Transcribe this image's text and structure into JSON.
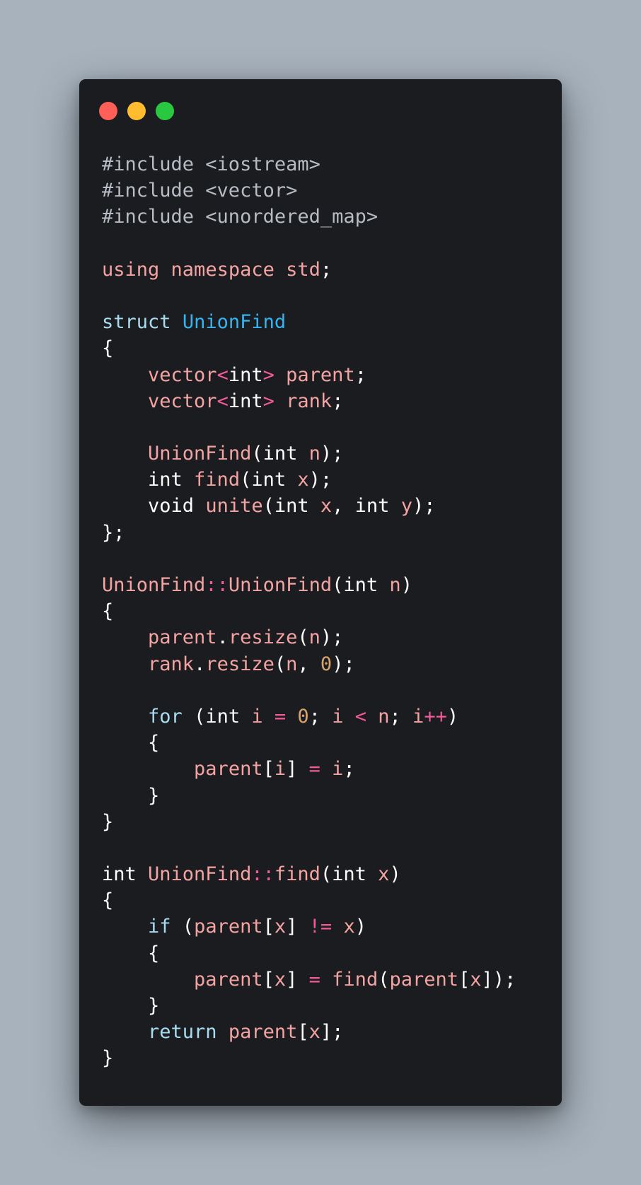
{
  "window": {
    "controls": [
      {
        "name": "close",
        "color": "#fe5f57"
      },
      {
        "name": "minimize",
        "color": "#febc2e"
      },
      {
        "name": "maximize",
        "color": "#28c840"
      }
    ]
  },
  "code": {
    "language": "cpp",
    "lines": [
      [
        {
          "t": "#include <iostream>",
          "c": "pre"
        }
      ],
      [
        {
          "t": "#include <vector>",
          "c": "pre"
        }
      ],
      [
        {
          "t": "#include <unordered_map>",
          "c": "pre"
        }
      ],
      [],
      [
        {
          "t": "using",
          "c": "kw"
        },
        {
          "t": " ",
          "c": "plain"
        },
        {
          "t": "namespace",
          "c": "kw"
        },
        {
          "t": " ",
          "c": "plain"
        },
        {
          "t": "std",
          "c": "kw"
        },
        {
          "t": ";",
          "c": "plain"
        }
      ],
      [],
      [
        {
          "t": "struct",
          "c": "struct"
        },
        {
          "t": " ",
          "c": "plain"
        },
        {
          "t": "UnionFind",
          "c": "type"
        }
      ],
      [
        {
          "t": "{",
          "c": "plain"
        }
      ],
      [
        {
          "t": "    ",
          "c": "plain"
        },
        {
          "t": "vector",
          "c": "ident"
        },
        {
          "t": "<",
          "c": "op"
        },
        {
          "t": "int",
          "c": "plain"
        },
        {
          "t": ">",
          "c": "op"
        },
        {
          "t": " ",
          "c": "plain"
        },
        {
          "t": "parent",
          "c": "ident"
        },
        {
          "t": ";",
          "c": "plain"
        }
      ],
      [
        {
          "t": "    ",
          "c": "plain"
        },
        {
          "t": "vector",
          "c": "ident"
        },
        {
          "t": "<",
          "c": "op"
        },
        {
          "t": "int",
          "c": "plain"
        },
        {
          "t": ">",
          "c": "op"
        },
        {
          "t": " ",
          "c": "plain"
        },
        {
          "t": "rank",
          "c": "ident"
        },
        {
          "t": ";",
          "c": "plain"
        }
      ],
      [],
      [
        {
          "t": "    ",
          "c": "plain"
        },
        {
          "t": "UnionFind",
          "c": "ident"
        },
        {
          "t": "(int ",
          "c": "plain"
        },
        {
          "t": "n",
          "c": "ident"
        },
        {
          "t": ");",
          "c": "plain"
        }
      ],
      [
        {
          "t": "    int ",
          "c": "plain"
        },
        {
          "t": "find",
          "c": "ident"
        },
        {
          "t": "(int ",
          "c": "plain"
        },
        {
          "t": "x",
          "c": "ident"
        },
        {
          "t": ");",
          "c": "plain"
        }
      ],
      [
        {
          "t": "    void ",
          "c": "plain"
        },
        {
          "t": "unite",
          "c": "ident"
        },
        {
          "t": "(int ",
          "c": "plain"
        },
        {
          "t": "x",
          "c": "ident"
        },
        {
          "t": ", int ",
          "c": "plain"
        },
        {
          "t": "y",
          "c": "ident"
        },
        {
          "t": ");",
          "c": "plain"
        }
      ],
      [
        {
          "t": "};",
          "c": "plain"
        }
      ],
      [],
      [
        {
          "t": "UnionFind",
          "c": "ident"
        },
        {
          "t": "::",
          "c": "op"
        },
        {
          "t": "UnionFind",
          "c": "ident"
        },
        {
          "t": "(int ",
          "c": "plain"
        },
        {
          "t": "n",
          "c": "ident"
        },
        {
          "t": ")",
          "c": "plain"
        }
      ],
      [
        {
          "t": "{",
          "c": "plain"
        }
      ],
      [
        {
          "t": "    ",
          "c": "plain"
        },
        {
          "t": "parent",
          "c": "ident"
        },
        {
          "t": ".",
          "c": "plain"
        },
        {
          "t": "resize",
          "c": "ident"
        },
        {
          "t": "(",
          "c": "plain"
        },
        {
          "t": "n",
          "c": "ident"
        },
        {
          "t": ");",
          "c": "plain"
        }
      ],
      [
        {
          "t": "    ",
          "c": "plain"
        },
        {
          "t": "rank",
          "c": "ident"
        },
        {
          "t": ".",
          "c": "plain"
        },
        {
          "t": "resize",
          "c": "ident"
        },
        {
          "t": "(",
          "c": "plain"
        },
        {
          "t": "n",
          "c": "ident"
        },
        {
          "t": ", ",
          "c": "plain"
        },
        {
          "t": "0",
          "c": "num"
        },
        {
          "t": ");",
          "c": "plain"
        }
      ],
      [],
      [
        {
          "t": "    ",
          "c": "plain"
        },
        {
          "t": "for",
          "c": "ctrl"
        },
        {
          "t": " (int ",
          "c": "plain"
        },
        {
          "t": "i",
          "c": "ident"
        },
        {
          "t": " ",
          "c": "plain"
        },
        {
          "t": "=",
          "c": "op"
        },
        {
          "t": " ",
          "c": "plain"
        },
        {
          "t": "0",
          "c": "num"
        },
        {
          "t": "; ",
          "c": "plain"
        },
        {
          "t": "i",
          "c": "ident"
        },
        {
          "t": " ",
          "c": "plain"
        },
        {
          "t": "<",
          "c": "op"
        },
        {
          "t": " ",
          "c": "plain"
        },
        {
          "t": "n",
          "c": "ident"
        },
        {
          "t": "; ",
          "c": "plain"
        },
        {
          "t": "i",
          "c": "ident"
        },
        {
          "t": "++",
          "c": "op"
        },
        {
          "t": ")",
          "c": "plain"
        }
      ],
      [
        {
          "t": "    {",
          "c": "plain"
        }
      ],
      [
        {
          "t": "        ",
          "c": "plain"
        },
        {
          "t": "parent",
          "c": "ident"
        },
        {
          "t": "[",
          "c": "plain"
        },
        {
          "t": "i",
          "c": "ident"
        },
        {
          "t": "] ",
          "c": "plain"
        },
        {
          "t": "=",
          "c": "op"
        },
        {
          "t": " ",
          "c": "plain"
        },
        {
          "t": "i",
          "c": "ident"
        },
        {
          "t": ";",
          "c": "plain"
        }
      ],
      [
        {
          "t": "    }",
          "c": "plain"
        }
      ],
      [
        {
          "t": "}",
          "c": "plain"
        }
      ],
      [],
      [
        {
          "t": "int ",
          "c": "plain"
        },
        {
          "t": "UnionFind",
          "c": "ident"
        },
        {
          "t": "::",
          "c": "op"
        },
        {
          "t": "find",
          "c": "ident"
        },
        {
          "t": "(int ",
          "c": "plain"
        },
        {
          "t": "x",
          "c": "ident"
        },
        {
          "t": ")",
          "c": "plain"
        }
      ],
      [
        {
          "t": "{",
          "c": "plain"
        }
      ],
      [
        {
          "t": "    ",
          "c": "plain"
        },
        {
          "t": "if",
          "c": "ctrl"
        },
        {
          "t": " (",
          "c": "plain"
        },
        {
          "t": "parent",
          "c": "ident"
        },
        {
          "t": "[",
          "c": "plain"
        },
        {
          "t": "x",
          "c": "ident"
        },
        {
          "t": "] ",
          "c": "plain"
        },
        {
          "t": "!=",
          "c": "op"
        },
        {
          "t": " ",
          "c": "plain"
        },
        {
          "t": "x",
          "c": "ident"
        },
        {
          "t": ")",
          "c": "plain"
        }
      ],
      [
        {
          "t": "    {",
          "c": "plain"
        }
      ],
      [
        {
          "t": "        ",
          "c": "plain"
        },
        {
          "t": "parent",
          "c": "ident"
        },
        {
          "t": "[",
          "c": "plain"
        },
        {
          "t": "x",
          "c": "ident"
        },
        {
          "t": "] ",
          "c": "plain"
        },
        {
          "t": "=",
          "c": "op"
        },
        {
          "t": " ",
          "c": "plain"
        },
        {
          "t": "find",
          "c": "ident"
        },
        {
          "t": "(",
          "c": "plain"
        },
        {
          "t": "parent",
          "c": "ident"
        },
        {
          "t": "[",
          "c": "plain"
        },
        {
          "t": "x",
          "c": "ident"
        },
        {
          "t": "]);",
          "c": "plain"
        }
      ],
      [
        {
          "t": "    }",
          "c": "plain"
        }
      ],
      [
        {
          "t": "    ",
          "c": "plain"
        },
        {
          "t": "return",
          "c": "ctrl"
        },
        {
          "t": " ",
          "c": "plain"
        },
        {
          "t": "parent",
          "c": "ident"
        },
        {
          "t": "[",
          "c": "plain"
        },
        {
          "t": "x",
          "c": "ident"
        },
        {
          "t": "];",
          "c": "plain"
        }
      ],
      [
        {
          "t": "}",
          "c": "plain"
        }
      ]
    ]
  }
}
